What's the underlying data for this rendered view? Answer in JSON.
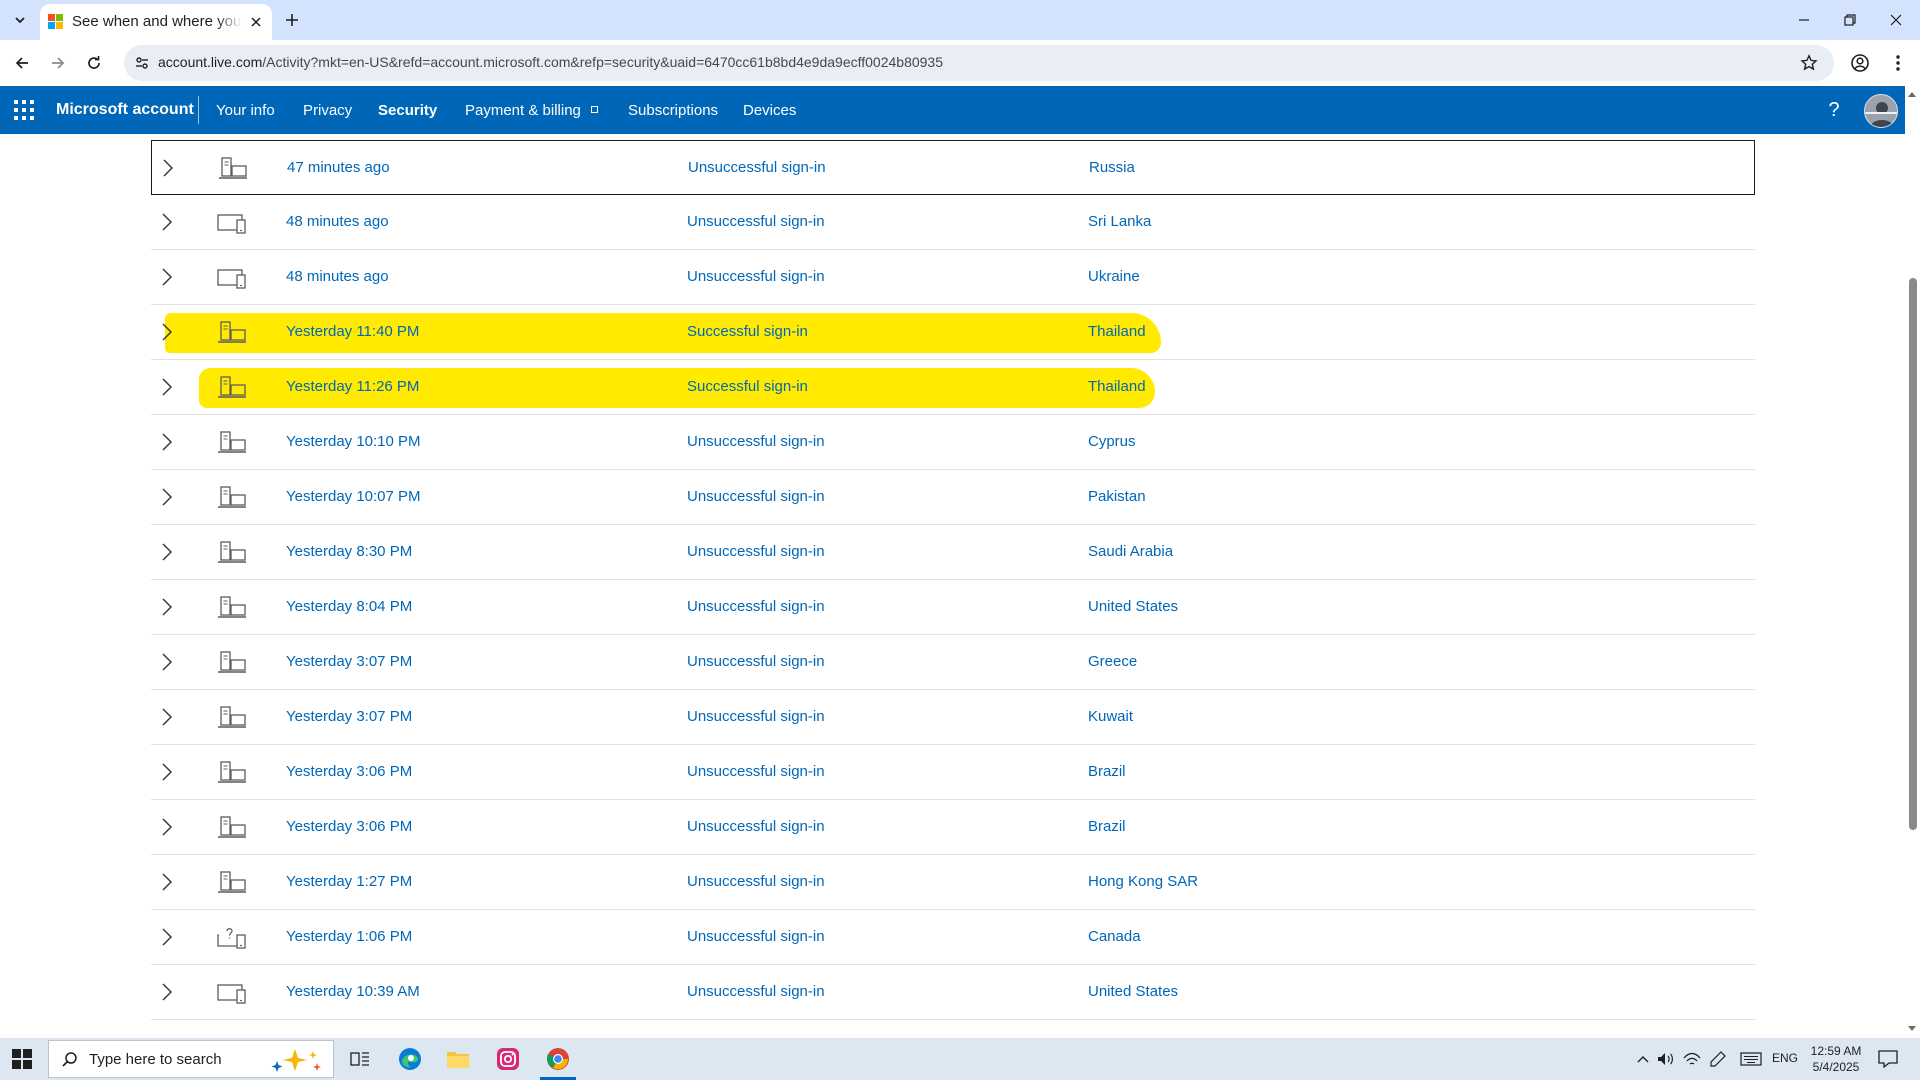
{
  "browser": {
    "tab_title": "See when and where you",
    "url_host": "account.live.com",
    "url_rest": "/Activity?mkt=en-US&refd=account.microsoft.com&refp=security&uaid=6470cc61b8bd4e9da9ecff0024b80935"
  },
  "header": {
    "brand": "Microsoft account",
    "nav": [
      "Your info",
      "Privacy",
      "Security",
      "Payment & billing",
      "Subscriptions",
      "Devices"
    ],
    "active_nav": "Security",
    "help": "?"
  },
  "colors": {
    "header_bg": "#0067b8",
    "link": "#0067b8",
    "highlight": "#ffea00",
    "tabstrip": "#d3e3fd",
    "taskbar": "#dde7f2"
  },
  "activity": [
    {
      "when": "47 minutes ago",
      "event": "Unsuccessful sign-in",
      "location": "Russia",
      "device": "desktop-icon",
      "focused": true,
      "highlighted": false
    },
    {
      "when": "48 minutes ago",
      "event": "Unsuccessful sign-in",
      "location": "Sri Lanka",
      "device": "phone-desktop-icon",
      "focused": false,
      "highlighted": false
    },
    {
      "when": "48 minutes ago",
      "event": "Unsuccessful sign-in",
      "location": "Ukraine",
      "device": "phone-desktop-icon",
      "focused": false,
      "highlighted": false
    },
    {
      "when": "Yesterday 11:40 PM",
      "event": "Successful sign-in",
      "location": "Thailand",
      "device": "desktop-icon",
      "focused": false,
      "highlighted": true
    },
    {
      "when": "Yesterday 11:26 PM",
      "event": "Successful sign-in",
      "location": "Thailand",
      "device": "desktop-icon",
      "focused": false,
      "highlighted": true
    },
    {
      "when": "Yesterday 10:10 PM",
      "event": "Unsuccessful sign-in",
      "location": "Cyprus",
      "device": "desktop-icon",
      "focused": false,
      "highlighted": false
    },
    {
      "when": "Yesterday 10:07 PM",
      "event": "Unsuccessful sign-in",
      "location": "Pakistan",
      "device": "desktop-icon",
      "focused": false,
      "highlighted": false
    },
    {
      "when": "Yesterday 8:30 PM",
      "event": "Unsuccessful sign-in",
      "location": "Saudi Arabia",
      "device": "desktop-icon",
      "focused": false,
      "highlighted": false
    },
    {
      "when": "Yesterday 8:04 PM",
      "event": "Unsuccessful sign-in",
      "location": "United States",
      "device": "desktop-icon",
      "focused": false,
      "highlighted": false
    },
    {
      "when": "Yesterday 3:07 PM",
      "event": "Unsuccessful sign-in",
      "location": "Greece",
      "device": "desktop-icon",
      "focused": false,
      "highlighted": false
    },
    {
      "when": "Yesterday 3:07 PM",
      "event": "Unsuccessful sign-in",
      "location": "Kuwait",
      "device": "desktop-icon",
      "focused": false,
      "highlighted": false
    },
    {
      "when": "Yesterday 3:06 PM",
      "event": "Unsuccessful sign-in",
      "location": "Brazil",
      "device": "desktop-icon",
      "focused": false,
      "highlighted": false
    },
    {
      "when": "Yesterday 3:06 PM",
      "event": "Unsuccessful sign-in",
      "location": "Brazil",
      "device": "desktop-icon",
      "focused": false,
      "highlighted": false
    },
    {
      "when": "Yesterday 1:27 PM",
      "event": "Unsuccessful sign-in",
      "location": "Hong Kong SAR",
      "device": "desktop-icon",
      "focused": false,
      "highlighted": false
    },
    {
      "when": "Yesterday 1:06 PM",
      "event": "Unsuccessful sign-in",
      "location": "Canada",
      "device": "unknown-device-icon",
      "focused": false,
      "highlighted": false
    },
    {
      "when": "Yesterday 10:39 AM",
      "event": "Unsuccessful sign-in",
      "location": "United States",
      "device": "phone-desktop-icon",
      "focused": false,
      "highlighted": false
    }
  ],
  "taskbar": {
    "search_placeholder": "Type here to search",
    "apps": [
      "task-view-icon",
      "edge-icon",
      "file-explorer-icon",
      "instagram-icon",
      "chrome-icon"
    ],
    "language": "ENG",
    "time": "12:59 AM",
    "date": "5/4/2025"
  }
}
